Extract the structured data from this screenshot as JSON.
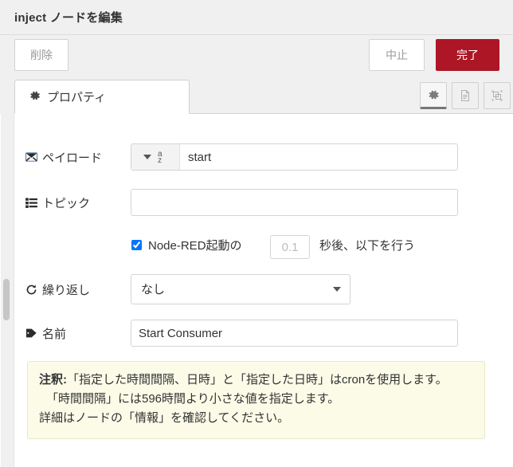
{
  "dialog": {
    "title": "inject ノードを編集"
  },
  "buttons": {
    "delete": "削除",
    "cancel": "中止",
    "done": "完了",
    "done_color": "#ad1625"
  },
  "tabs": [
    {
      "label": "プロパティ",
      "icon": "gear-icon",
      "active": true
    }
  ],
  "tab_icon_buttons": [
    {
      "name": "properties-gear-icon",
      "active": true
    },
    {
      "name": "description-document-icon",
      "active": false
    },
    {
      "name": "appearance-shape-icon",
      "active": false
    }
  ],
  "form": {
    "payload": {
      "label": "ペイロード",
      "icon": "envelope-icon",
      "type_icon": "az-string-icon",
      "value": "start",
      "placeholder": ""
    },
    "topic": {
      "label": "トピック",
      "icon": "tasks-list-icon",
      "value": "",
      "placeholder": ""
    },
    "startup": {
      "checked": true,
      "text_before": "Node-RED起動の",
      "delay_value": "",
      "delay_placeholder": "0.1",
      "text_after": "秒後、以下を行う"
    },
    "repeat": {
      "label": "繰り返し",
      "icon": "repeat-icon",
      "selected": "なし",
      "options": [
        "なし"
      ]
    },
    "name": {
      "label": "名前",
      "icon": "tag-icon",
      "value": "Start Consumer",
      "placeholder": ""
    }
  },
  "note": {
    "heading": "注釈:",
    "line1": "「指定した時間間隔、日時」と「指定した日時」はcronを使用します。",
    "line2": "「時間間隔」には596時間より小さな値を指定します。",
    "line3": "詳細はノードの「情報」を確認してください。"
  }
}
